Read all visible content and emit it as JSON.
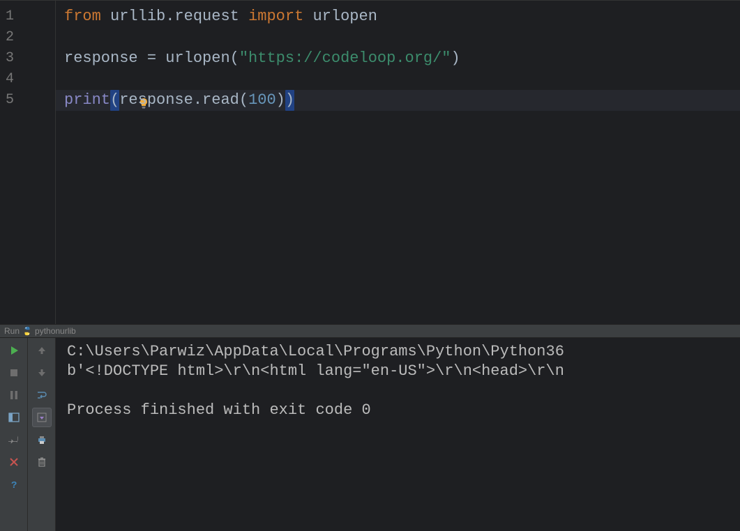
{
  "editor": {
    "lines": [
      "1",
      "2",
      "3",
      "4",
      "5"
    ],
    "code": {
      "l1_from": "from",
      "l1_sp1": " ",
      "l1_mod": "urllib.request",
      "l1_sp2": " ",
      "l1_import": "import",
      "l1_sp3": " ",
      "l1_name": "urlopen",
      "l3_var": "response ",
      "l3_eq": "= ",
      "l3_call": "urlopen(",
      "l3_str": "\"https://codeloop.org/\"",
      "l3_close": ")",
      "l5_print": "print",
      "l5_open": "(",
      "l5_resp": "response.read(",
      "l5_num": "100",
      "l5_close1": ")",
      "l5_close2": ")"
    }
  },
  "run_tab": {
    "label": "Run",
    "config": "pythonurlib"
  },
  "console": {
    "line1": "C:\\Users\\Parwiz\\AppData\\Local\\Programs\\Python\\Python36",
    "line2": "b'<!DOCTYPE html>\\r\\n<html lang=\"en-US\">\\r\\n<head>\\r\\n",
    "line3": "",
    "line4": "Process finished with exit code 0"
  },
  "icons": {
    "bulb": "bulb-icon",
    "run": "run-icon",
    "stop": "stop-icon",
    "pause": "pause-icon",
    "layout": "layout-icon",
    "pin": "pin-icon",
    "close": "close-icon",
    "help": "help-icon",
    "up": "up-icon",
    "down": "down-icon",
    "wrap": "wrap-icon",
    "scroll": "scroll-icon",
    "print": "print-icon",
    "trash": "trash-icon"
  }
}
